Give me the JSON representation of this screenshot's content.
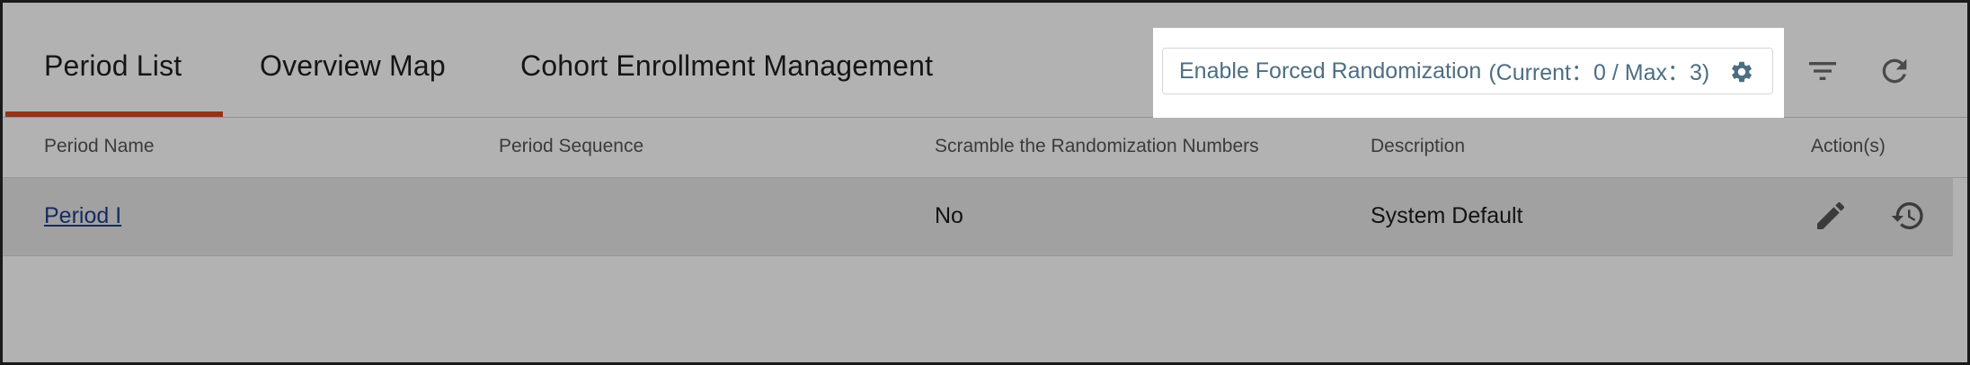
{
  "tabs": [
    {
      "label": "Period List",
      "active": true
    },
    {
      "label": "Overview Map",
      "active": false
    },
    {
      "label": "Cohort Enrollment Management",
      "active": false
    }
  ],
  "forced_randomization": {
    "label": "Enable Forced Randomization",
    "status": "(Current：0 / Max：3)",
    "icon": "gear-icon"
  },
  "toolbar": {
    "filter_icon": "filter-icon",
    "refresh_icon": "refresh-icon"
  },
  "table": {
    "columns": [
      "Period Name",
      "Period Sequence",
      "Scramble the Randomization Numbers",
      "Description",
      "Action(s)"
    ],
    "rows": [
      {
        "period_name": "Period I",
        "period_sequence": "",
        "scramble": "No",
        "description": "System Default",
        "actions": [
          "edit-icon",
          "history-icon"
        ]
      }
    ]
  },
  "colors": {
    "active_tab_underline": "#d24b25",
    "link": "#1f3e8a",
    "forced_text": "#4d6e82"
  }
}
